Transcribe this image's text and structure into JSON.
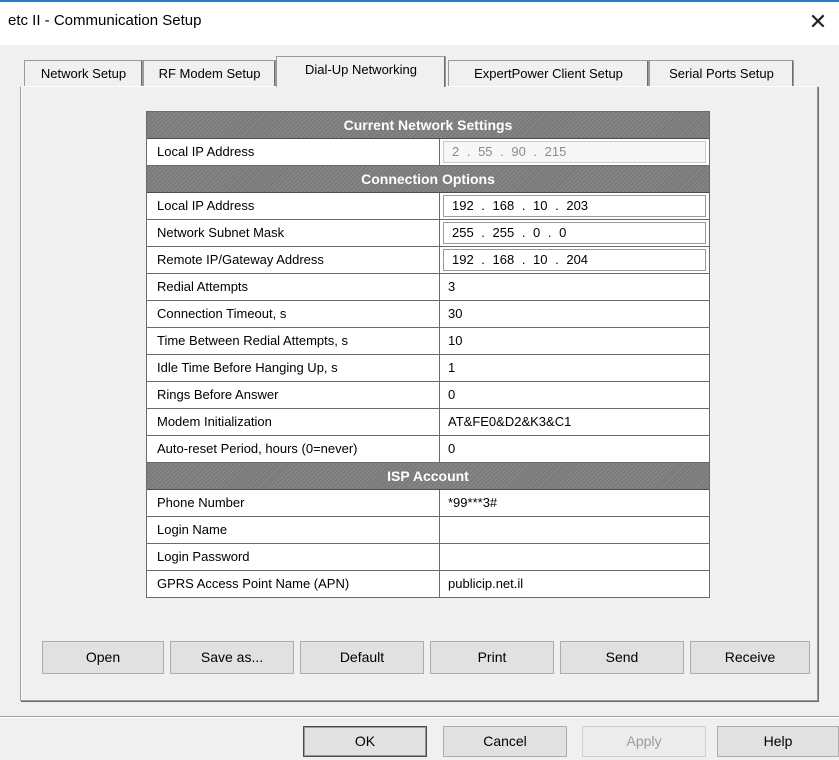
{
  "window": {
    "title": "etc II - Communication Setup",
    "close_glyph": "✕"
  },
  "tabs": [
    {
      "label": "Network Setup"
    },
    {
      "label": "RF Modem Setup"
    },
    {
      "label": "Dial-Up Networking",
      "active": true
    },
    {
      "label": "ExpertPower Client Setup"
    },
    {
      "label": "Serial Ports Setup"
    }
  ],
  "current_network": {
    "header": "Current Network Settings",
    "local_ip_label": "Local IP Address",
    "local_ip_value": "2  .  55  .  90  .  215"
  },
  "connection_options": {
    "header": "Connection Options",
    "rows": [
      {
        "label": "Local IP Address",
        "value": "192  .  168  .  10  .  203"
      },
      {
        "label": "Network Subnet Mask",
        "value": "255  .  255  .  0   .  0"
      },
      {
        "label": "Remote IP/Gateway Address",
        "value": "192  .  168  .  10  .  204"
      },
      {
        "label": "Redial Attempts",
        "value": "3"
      },
      {
        "label": "Connection Timeout, s",
        "value": "30"
      },
      {
        "label": "Time Between Redial Attempts, s",
        "value": "10"
      },
      {
        "label": "Idle Time Before Hanging Up, s",
        "value": "1"
      },
      {
        "label": "Rings Before Answer",
        "value": "0"
      },
      {
        "label": "Modem Initialization",
        "value": "AT&FE0&D2&K3&C1"
      },
      {
        "label": "Auto-reset Period, hours (0=never)",
        "value": "0"
      }
    ]
  },
  "isp_account": {
    "header": "ISP Account",
    "rows": [
      {
        "label": "Phone Number",
        "value": "*99***3#"
      },
      {
        "label": "Login Name",
        "value": ""
      },
      {
        "label": "Login Password",
        "value": ""
      },
      {
        "label": "GPRS Access Point Name (APN)",
        "value": "publicip.net.il"
      }
    ]
  },
  "actions": {
    "open": "Open",
    "save_as": "Save as...",
    "default": "Default",
    "print": "Print",
    "send": "Send",
    "receive": "Receive"
  },
  "dialog_buttons": {
    "ok": "OK",
    "cancel": "Cancel",
    "apply": "Apply",
    "help": "Help"
  }
}
